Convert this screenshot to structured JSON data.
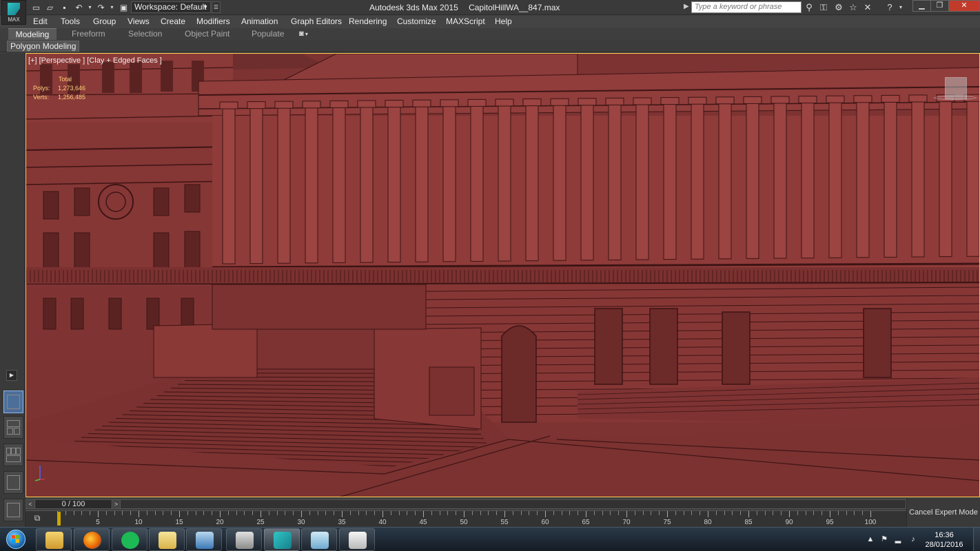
{
  "app": {
    "logo_text": "MAX",
    "title_app": "Autodesk 3ds Max  2015",
    "title_file": "CapitolHillWA__847.max",
    "workspace": "Workspace: Default"
  },
  "search": {
    "placeholder": "Type a keyword or phrase"
  },
  "menu": {
    "items": [
      "Edit",
      "Tools",
      "Group",
      "Views",
      "Create",
      "Modifiers",
      "Animation",
      "Graph Editors",
      "Rendering",
      "Customize",
      "MAXScript",
      "Help"
    ]
  },
  "ribbon": {
    "tabs": [
      "Modeling",
      "Freeform",
      "Selection",
      "Object Paint",
      "Populate"
    ],
    "active_tab": "Modeling",
    "panel_label": "Polygon Modeling"
  },
  "viewport": {
    "label": "[+] [Perspective ] [Clay + Edged Faces ]",
    "stats_header": "Total",
    "polys_label": "Polys:",
    "polys_value": "1,273,646",
    "verts_label": "Verts:",
    "verts_value": "1,256,485",
    "background_color": "#7d3332",
    "highlight_color": "#ffcf52"
  },
  "timeline": {
    "frame_indicator": "0 / 100",
    "tick_labels": [
      "5",
      "10",
      "15",
      "20",
      "25",
      "30",
      "35",
      "40",
      "45",
      "50",
      "55",
      "60",
      "65",
      "70",
      "75",
      "80",
      "85",
      "90",
      "95",
      "100"
    ],
    "current_frame": 0,
    "cancel_expert_label": "Cancel Expert Mode"
  },
  "taskbar": {
    "apps": [
      "windows-explorer-icon",
      "firefox-icon",
      "spotify-icon",
      "file-manager-icon",
      "remote-desktop-icon",
      "sketchup-icon",
      "3ds-max-icon",
      "notes-icon",
      "calculator-icon"
    ],
    "clock_time": "16:36",
    "clock_date": "28/01/2016"
  }
}
